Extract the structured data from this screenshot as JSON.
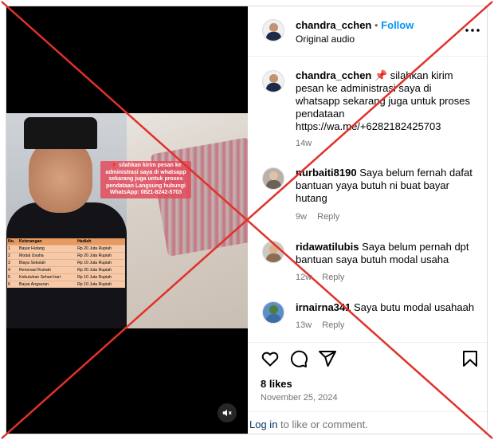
{
  "post": {
    "overlay_text": "📌 silahkan kirim pesan ke administrasi saya di whatsapp sekarang juga untuk proses pendataan Langsung hubungi WhatsApp: 0821-8242-5703",
    "table": {
      "headers": [
        "No.",
        "Keterangan",
        "Hadiah"
      ],
      "rows": [
        [
          "1",
          "Bayar Hutang",
          "Rp 20 Juta Rupiah"
        ],
        [
          "2",
          "Modal Usaha",
          "Rp 20 Juta Rupiah"
        ],
        [
          "3",
          "Biaya Sekolah",
          "Rp 10 Juta Rupiah"
        ],
        [
          "4",
          "Renovasi Rumah",
          "Rp 20 Juta Rupiah"
        ],
        [
          "5",
          "Kebutuhan Sehari-hari",
          "Rp 10 Juta Rupiah"
        ],
        [
          "6",
          "Bayar Angsuran",
          "Rp 10 Juta Rupiah"
        ]
      ]
    },
    "mute_icon": "speaker-muted-icon"
  },
  "header": {
    "username": "chandra_cchen",
    "separator": "•",
    "follow_label": "Follow",
    "subtitle": "Original audio",
    "more_icon": "more-dots-icon"
  },
  "comments": [
    {
      "username": "chandra_cchen",
      "text": "📌 silahkan kirim pesan ke administrasi saya di whatsapp sekarang juga untuk proses pendataan https://wa.me/+6282182425703",
      "age": "14w",
      "reply": ""
    },
    {
      "username": "nurbaiti8190",
      "text": "Saya belum fernah dafat bantuan yaya butuh ni buat bayar hutang",
      "age": "9w",
      "reply": "Reply"
    },
    {
      "username": "ridawatilubis",
      "text": "Saya belum pernah dpt bantuan saya butuh modal usaha",
      "age": "12w",
      "reply": "Reply"
    },
    {
      "username": "irnairna341",
      "text": "Saya butu modal usahaah",
      "age": "13w",
      "reply": "Reply"
    }
  ],
  "actions": {
    "like_icon": "heart-icon",
    "comment_icon": "comment-bubble-icon",
    "share_icon": "paper-plane-icon",
    "save_icon": "bookmark-icon"
  },
  "likes": "8 likes",
  "date": "November 25, 2024",
  "login": {
    "link": "Log in",
    "rest": " to like or comment."
  },
  "colors": {
    "cross": "#e0312a",
    "link_blue": "#0095f6",
    "muted_text": "#737373"
  }
}
